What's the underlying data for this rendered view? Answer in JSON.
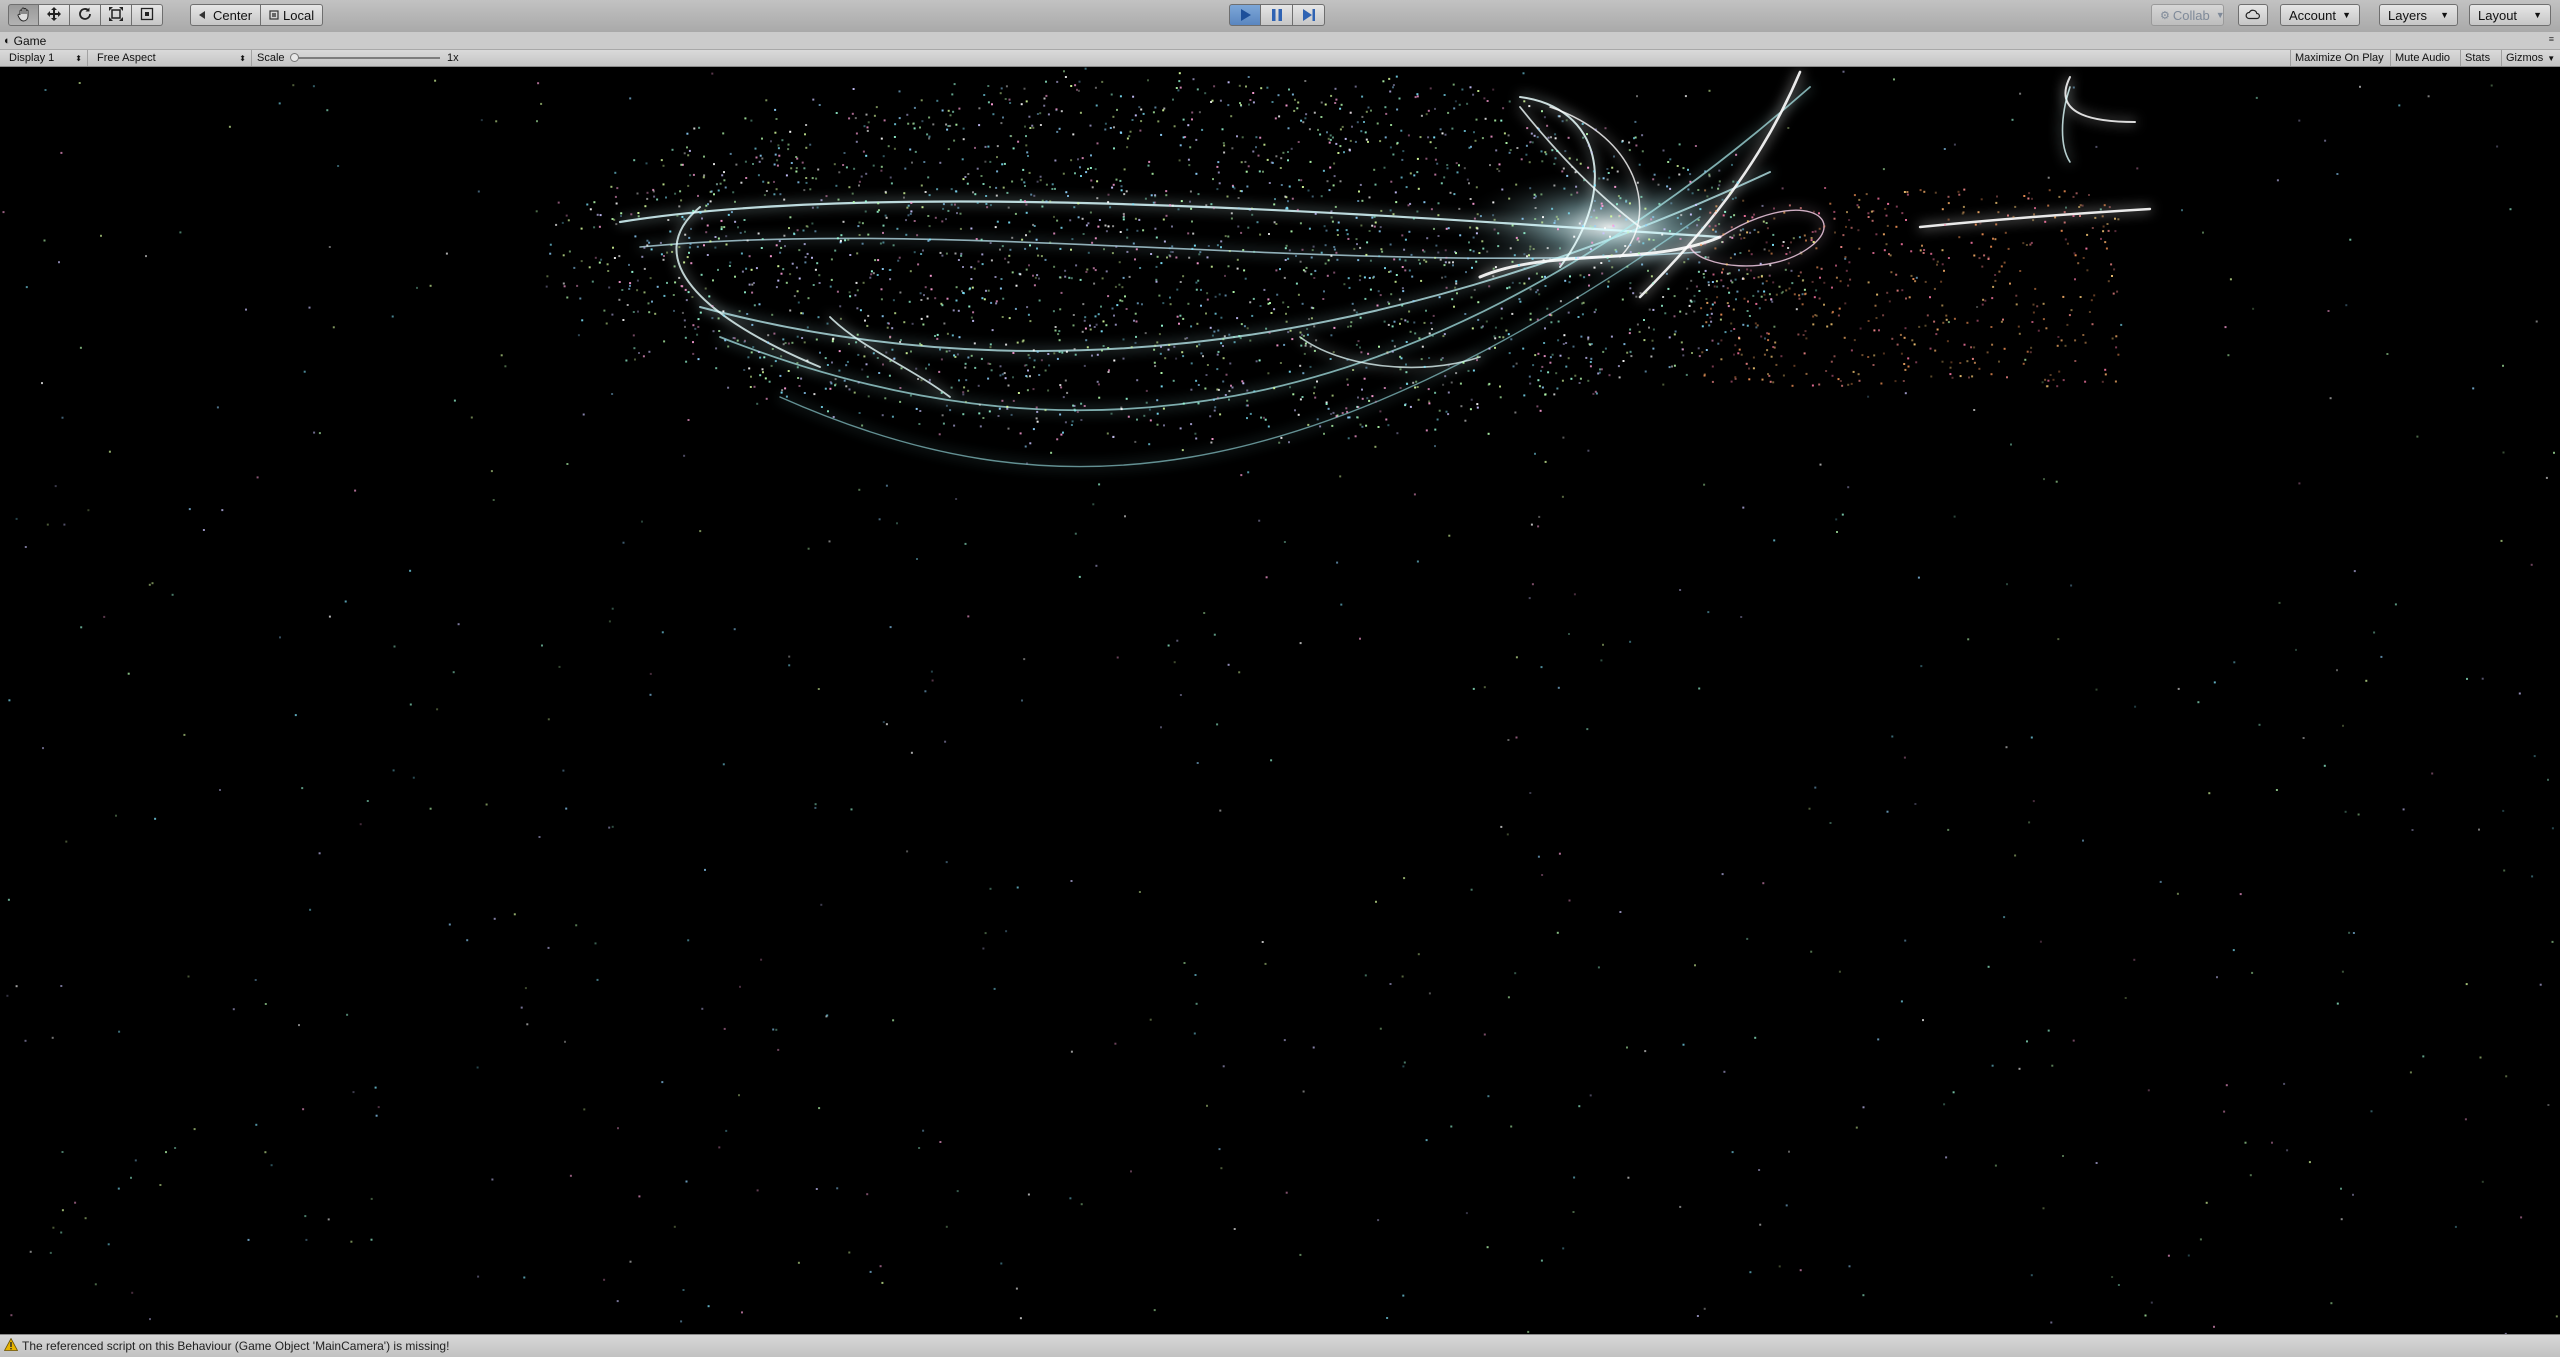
{
  "toolbar": {
    "tools": [
      {
        "name": "hand-tool-button",
        "icon": "hand-icon"
      },
      {
        "name": "move-tool-button",
        "icon": "move-icon"
      },
      {
        "name": "rotate-tool-button",
        "icon": "rotate-icon"
      },
      {
        "name": "scale-tool-button",
        "icon": "scale-icon"
      },
      {
        "name": "rect-tool-button",
        "icon": "rect-tool-icon"
      }
    ],
    "pivot_label": "Center",
    "space_label": "Local",
    "collab_label": "Collab",
    "account_label": "Account",
    "layers_label": "Layers",
    "layout_label": "Layout",
    "play_accent": "#4a7cc6"
  },
  "tab": {
    "title": "Game"
  },
  "game_controls": {
    "display": "Display 1",
    "aspect": "Free Aspect",
    "scale_label": "Scale",
    "scale_value": "1x",
    "maximize_on_play": "Maximize On Play",
    "mute_audio": "Mute Audio",
    "stats": "Stats",
    "gizmos": "Gizmos"
  },
  "status": {
    "message": "The referenced script on this Behaviour (Game Object 'MainCamera') is missing!",
    "warning_color": "#e8b400"
  }
}
